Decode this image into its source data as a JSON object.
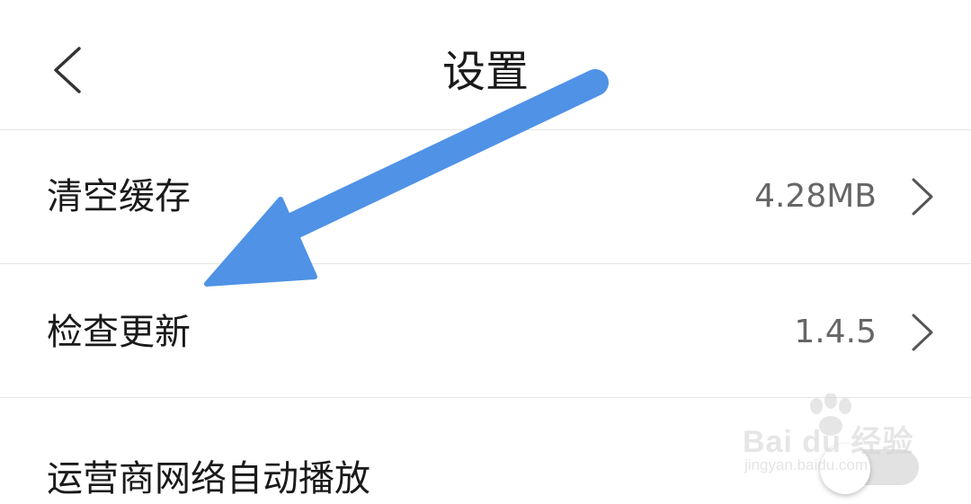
{
  "header": {
    "title": "设置",
    "back_icon": "chevron-left-icon"
  },
  "settings": [
    {
      "label": "清空缓存",
      "value": "4.28MB",
      "icon": "chevron-right-icon"
    },
    {
      "label": "检查更新",
      "value": "1.4.5",
      "icon": "chevron-right-icon"
    },
    {
      "label": "运营商网络自动播放",
      "toggle_on": false
    }
  ],
  "annotation": {
    "arrow_color": "#4f92e6"
  },
  "watermark": {
    "main": "Bai du 经验",
    "sub": "jingyan.baidu.com"
  },
  "colors": {
    "text_primary": "#1a1a1a",
    "text_secondary": "#666666",
    "divider": "#e6e6e6",
    "toggle_off": "#e2e2e2"
  }
}
